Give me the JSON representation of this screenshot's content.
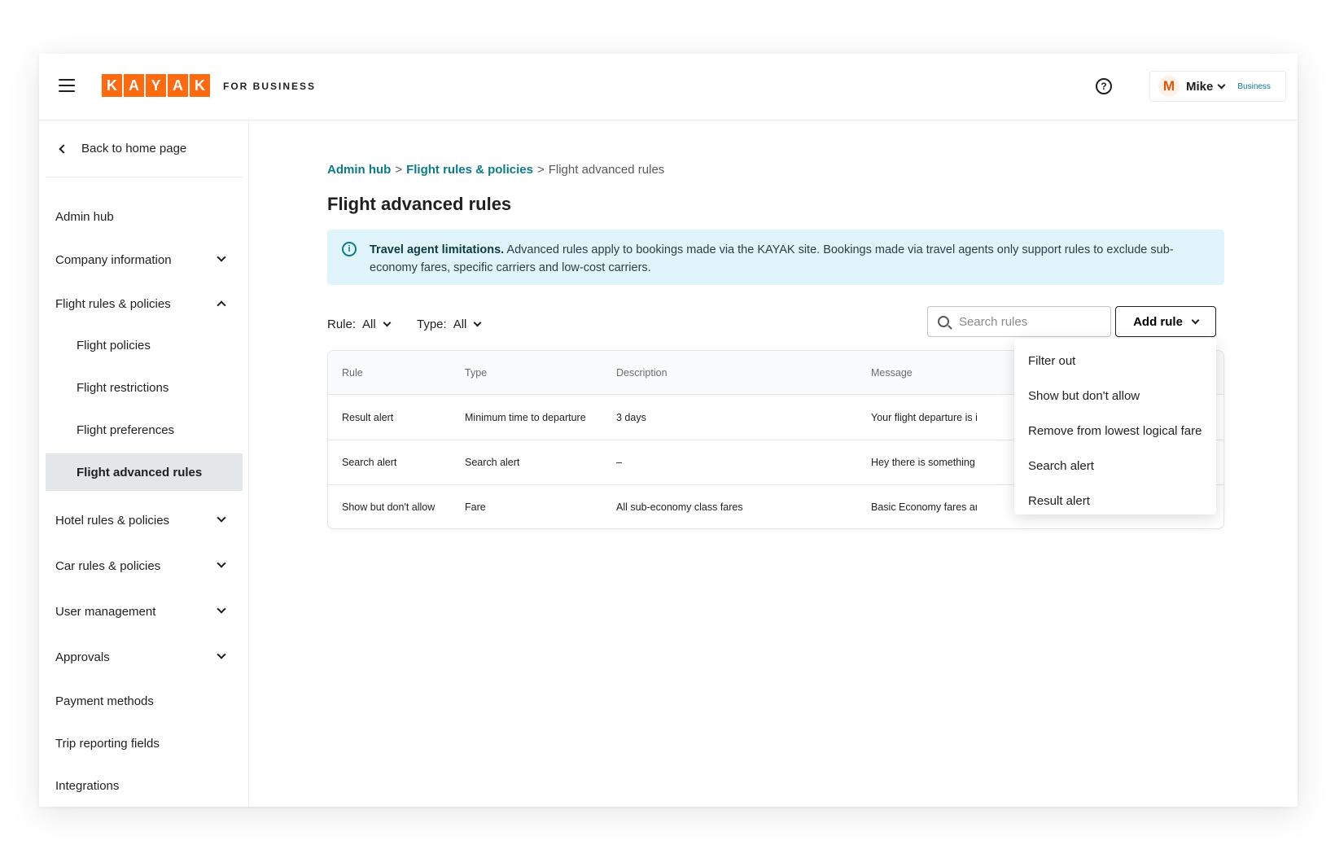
{
  "header": {
    "logo_letters": [
      "K",
      "A",
      "Y",
      "A",
      "K"
    ],
    "logo_sub": "FOR BUSINESS",
    "help_label": "?",
    "user": {
      "initial": "M",
      "name": "Mike",
      "badge": "Business"
    }
  },
  "sidebar": {
    "back_label": "Back to home page",
    "items": [
      {
        "label": "Admin hub"
      },
      {
        "label": "Company information"
      },
      {
        "label": "Flight rules & policies"
      },
      {
        "label": "Flight policies"
      },
      {
        "label": "Flight restrictions"
      },
      {
        "label": "Flight preferences"
      },
      {
        "label": "Flight advanced rules"
      },
      {
        "label": "Hotel rules & policies"
      },
      {
        "label": "Car rules & policies"
      },
      {
        "label": "User management"
      },
      {
        "label": "Approvals"
      },
      {
        "label": "Payment methods"
      },
      {
        "label": "Trip reporting fields"
      },
      {
        "label": "Integrations"
      }
    ]
  },
  "breadcrumb": {
    "items": [
      "Admin hub",
      "Flight rules & policies",
      "Flight advanced rules"
    ],
    "separator": ">"
  },
  "page_title": "Flight advanced rules",
  "banner": {
    "icon": "i",
    "title": "Travel agent limitations.",
    "text": "Advanced rules apply to bookings made via the KAYAK site. Bookings made via travel agents only support rules to exclude sub-economy fares, specific carriers and low-cost carriers."
  },
  "filters": {
    "rule": {
      "label": "Rule:",
      "value": "All"
    },
    "type": {
      "label": "Type:",
      "value": "All"
    }
  },
  "search": {
    "placeholder": "Search rules",
    "value": ""
  },
  "add_rule_label": "Add rule",
  "table": {
    "columns": [
      "Rule",
      "Type",
      "Description",
      "Message"
    ],
    "rows": [
      [
        "Result alert",
        "Minimum time to departure",
        "3 days",
        "Your flight departure is in"
      ],
      [
        "Search alert",
        "Search alert",
        "–",
        "Hey there is something to"
      ],
      [
        "Show but don't allow",
        "Fare",
        "All sub-economy class fares",
        "Basic Economy fares are"
      ]
    ]
  },
  "dropdown": {
    "items": [
      "Filter out",
      "Show but don't allow",
      "Remove from lowest logical fare",
      "Search alert",
      "Result alert"
    ]
  },
  "colors": {
    "brand": "#ff690f",
    "link": "#0b7a8c",
    "banner_bg": "#e0f5fb",
    "active_bg": "#e3e7ea"
  }
}
